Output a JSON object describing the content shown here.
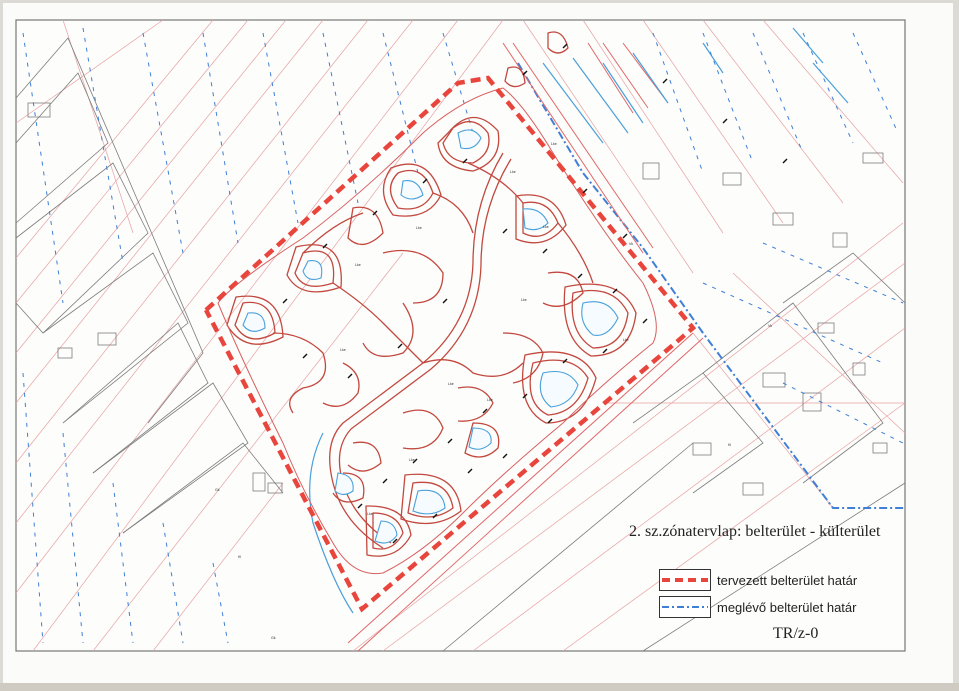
{
  "title": "2. sz.zónatervlap: belterület - külterület",
  "legend": [
    {
      "label": "tervezett belterület határ",
      "color": "#e8453c",
      "style": "dashed-thick"
    },
    {
      "label": "meglévő belterület határ",
      "color": "#3f7fd6",
      "style": "dash-dot"
    }
  ],
  "sheet_code": "TR/z-0",
  "colors": {
    "proposed_boundary": "#e8453c",
    "existing_boundary": "#3f7fd6",
    "parcel_lines": "#e79a9a",
    "roads": "#c2493f",
    "water": "#5aa6d8",
    "lot_lines": "#8a8a8a"
  },
  "map_labels": [
    {
      "id": "l1",
      "text": "Lke"
    },
    {
      "id": "l2",
      "text": "Lke"
    },
    {
      "id": "l3",
      "text": "Lke"
    },
    {
      "id": "l4",
      "text": "Lke"
    },
    {
      "id": "l5",
      "text": "Lke"
    },
    {
      "id": "l6",
      "text": "Lke"
    },
    {
      "id": "l7",
      "text": "Lke"
    },
    {
      "id": "l8",
      "text": "Lke"
    },
    {
      "id": "l9",
      "text": "Lke"
    },
    {
      "id": "l10",
      "text": "Lke"
    },
    {
      "id": "l11",
      "text": "Lke"
    },
    {
      "id": "l12",
      "text": "Lke"
    },
    {
      "id": "l13",
      "text": "Vk"
    },
    {
      "id": "l14",
      "text": "Kl"
    },
    {
      "id": "l15",
      "text": "Gk"
    },
    {
      "id": "l16",
      "text": "Gk"
    },
    {
      "id": "l17",
      "text": "Kl"
    },
    {
      "id": "l18",
      "text": "Vk"
    }
  ]
}
